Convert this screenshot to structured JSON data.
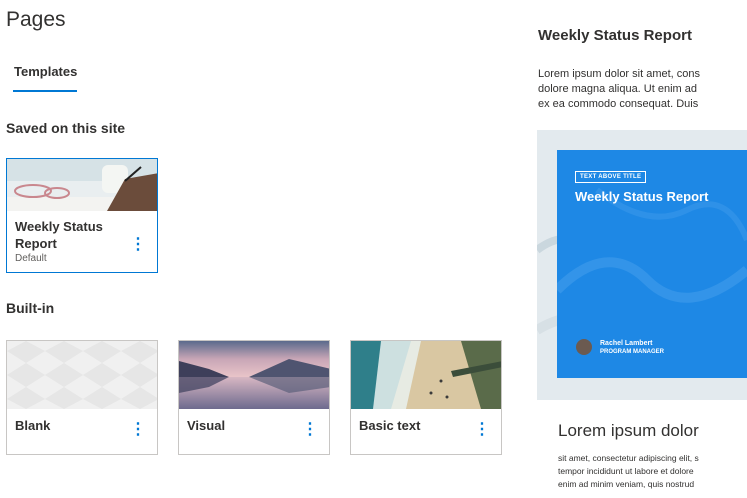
{
  "page": {
    "title": "Pages"
  },
  "tabs": [
    {
      "label": "Templates",
      "active": true
    }
  ],
  "saved": {
    "heading": "Saved on this site",
    "items": [
      {
        "title_line1": "Weekly Status",
        "title_line2": "Report",
        "subtitle": "Default"
      }
    ]
  },
  "builtin": {
    "heading": "Built-in",
    "items": [
      {
        "title": "Blank"
      },
      {
        "title": "Visual"
      },
      {
        "title": "Basic text"
      }
    ]
  },
  "preview": {
    "title": "Weekly Status Report",
    "desc_lines": [
      "Lorem ipsum dolor sit amet, cons",
      "dolore magna aliqua. Ut enim ad",
      "ex ea commodo consequat. Duis"
    ],
    "hero": {
      "tag": "TEXT ABOVE TITLE",
      "title": "Weekly Status Report",
      "author_name": "Rachel Lambert",
      "author_role": "PROGRAM MANAGER"
    },
    "body_heading": "Lorem ipsum dolor",
    "body_lines": [
      "sit amet, consectetur adipiscing elit, s",
      "tempor incididunt ut labore et dolore",
      "enim ad minim veniam, quis nostrud"
    ]
  },
  "colors": {
    "accent": "#0078d4",
    "hero_blue": "#1e88e5"
  },
  "icons": {
    "more": "more-vertical-icon"
  }
}
